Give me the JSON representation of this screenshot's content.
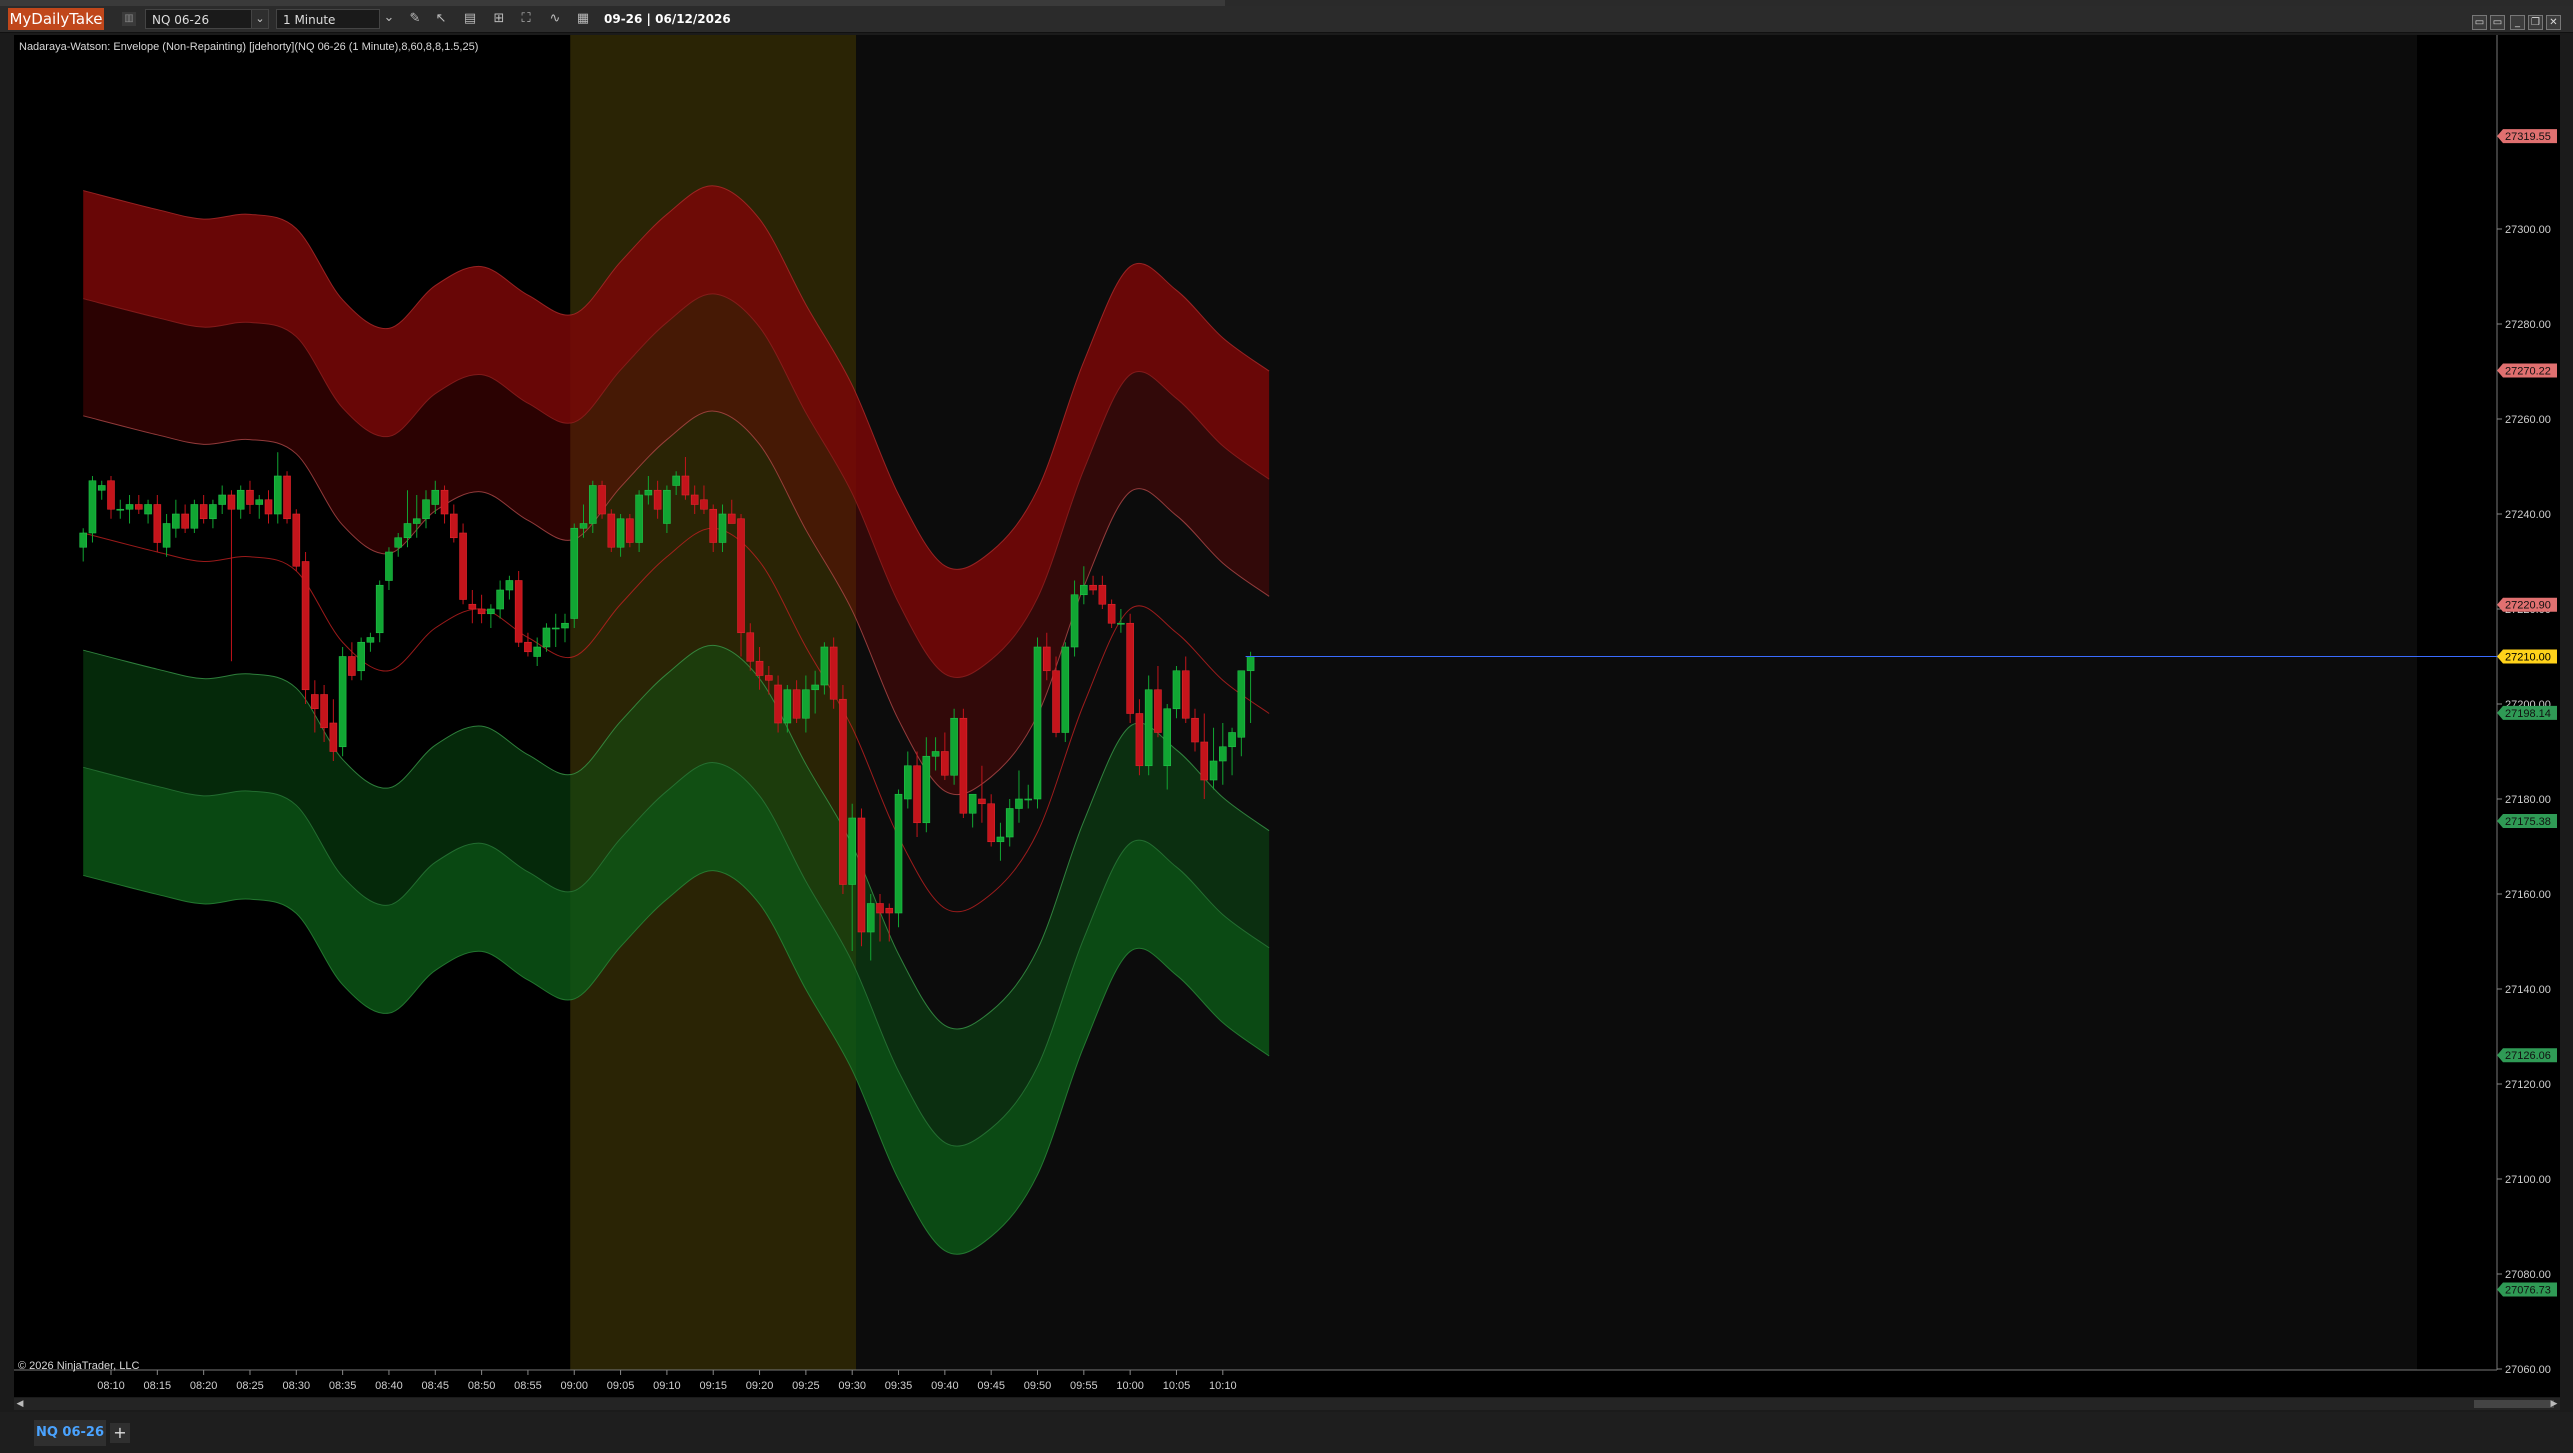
{
  "toolbar": {
    "brand": "MyDailyTake",
    "instrument": "NQ 06-26",
    "interval": "1 Minute",
    "datetime": "09-26 | 06/12/2026"
  },
  "chart": {
    "indicator_label": "Nadaraya-Watson: Envelope (Non-Repainting) [jdehorty](NQ 06-26 (1 Minute),8,60,8,8,1.5,25)",
    "copyright": "© 2026 NinjaTrader, LLC"
  },
  "tab": {
    "label": "NQ 06-26",
    "add": "+"
  },
  "colors": {
    "background": "#000000",
    "up": "#11a633",
    "down": "#c4141b",
    "band_red": "#7a0707",
    "band_green": "#0b5a16",
    "session_highlight": "#2a2405",
    "current_price": "#ffd21a"
  },
  "chart_data": {
    "type": "candlestick",
    "x_minutes": [
      488,
      494
    ],
    "ylim": [
      27060,
      27330
    ],
    "y_ticks": [
      27060,
      27080,
      27100,
      27120,
      27140,
      27160,
      27180,
      27200,
      27220,
      27240,
      27260,
      27280,
      27300
    ],
    "x_ticks": [
      "08:10",
      "08:15",
      "08:20",
      "08:25",
      "08:30",
      "08:35",
      "08:40",
      "08:45",
      "08:50",
      "08:55",
      "09:00",
      "09:05",
      "09:10",
      "09:15",
      "09:20",
      "09:25",
      "09:30",
      "09:35",
      "09:40",
      "09:45",
      "09:50",
      "09:55",
      "10:00",
      "10:05",
      "10:10"
    ],
    "time_range": [
      "08:07",
      "10:15"
    ],
    "highlight_range": [
      "09:00",
      "09:30"
    ],
    "price_labels": [
      {
        "value": 27319.55,
        "text": "27319.55",
        "color": "#e07070"
      },
      {
        "value": 27270.22,
        "text": "27270.22",
        "color": "#e07070"
      },
      {
        "value": 27220.9,
        "text": "27220.90",
        "color": "#e07070"
      },
      {
        "value": 27210.0,
        "text": "27210.00",
        "color": "#ffd21a"
      },
      {
        "value": 27198.14,
        "text": "27198.14",
        "color": "#2f9a55"
      },
      {
        "value": 27175.38,
        "text": "27175.38",
        "color": "#2f9a55"
      },
      {
        "value": 27126.06,
        "text": "27126.06",
        "color": "#2f9a55"
      },
      {
        "value": 27076.73,
        "text": "27076.73",
        "color": "#2f9a55"
      }
    ],
    "envelope": {
      "times": [
        "08:07",
        "08:15",
        "08:20",
        "08:25",
        "08:30",
        "08:35",
        "08:40",
        "08:45",
        "08:50",
        "08:55",
        "09:00",
        "09:05",
        "09:10",
        "09:15",
        "09:20",
        "09:25",
        "09:30",
        "09:35",
        "09:40",
        "09:45",
        "09:50",
        "09:55",
        "10:00",
        "10:05",
        "10:10",
        "10:15"
      ],
      "mid": [
        27236,
        27232,
        27230,
        27231,
        27228,
        27213,
        27207,
        27216,
        27220,
        27214,
        27210,
        27221,
        27231,
        27237,
        27230,
        27212,
        27195,
        27172,
        27157,
        27160,
        27173,
        27200,
        27220,
        27215,
        27205,
        27198
      ],
      "offsets": [
        24.67,
        49.33,
        72.09
      ]
    },
    "candles": [
      {
        "t": "08:07",
        "o": 27233,
        "h": 27237,
        "l": 27230,
        "c": 27236
      },
      {
        "t": "08:08",
        "o": 27236,
        "h": 27248,
        "l": 27234,
        "c": 27247
      },
      {
        "t": "08:09",
        "o": 27245,
        "h": 27247,
        "l": 27243,
        "c": 27246
      },
      {
        "t": "08:10",
        "o": 27247,
        "h": 27248,
        "l": 27239,
        "c": 27241
      },
      {
        "t": "08:11",
        "o": 27241,
        "h": 27243,
        "l": 27239,
        "c": 27241
      },
      {
        "t": "08:12",
        "o": 27241,
        "h": 27244,
        "l": 27238,
        "c": 27242
      },
      {
        "t": "08:13",
        "o": 27242,
        "h": 27244,
        "l": 27240,
        "c": 27241
      },
      {
        "t": "08:14",
        "o": 27240,
        "h": 27243,
        "l": 27238,
        "c": 27242
      },
      {
        "t": "08:15",
        "o": 27242,
        "h": 27244,
        "l": 27232,
        "c": 27234
      },
      {
        "t": "08:16",
        "o": 27233,
        "h": 27240,
        "l": 27231,
        "c": 27238
      },
      {
        "t": "08:17",
        "o": 27237,
        "h": 27243,
        "l": 27235,
        "c": 27240
      },
      {
        "t": "08:18",
        "o": 27240,
        "h": 27242,
        "l": 27236,
        "c": 27237
      },
      {
        "t": "08:19",
        "o": 27237,
        "h": 27243,
        "l": 27236,
        "c": 27242
      },
      {
        "t": "08:20",
        "o": 27242,
        "h": 27244,
        "l": 27238,
        "c": 27239
      },
      {
        "t": "08:21",
        "o": 27239,
        "h": 27243,
        "l": 27237,
        "c": 27242
      },
      {
        "t": "08:22",
        "o": 27242,
        "h": 27246,
        "l": 27240,
        "c": 27244
      },
      {
        "t": "08:23",
        "o": 27244,
        "h": 27245,
        "l": 27209,
        "c": 27241
      },
      {
        "t": "08:24",
        "o": 27241,
        "h": 27246,
        "l": 27239,
        "c": 27245
      },
      {
        "t": "08:25",
        "o": 27245,
        "h": 27247,
        "l": 27240,
        "c": 27242
      },
      {
        "t": "08:26",
        "o": 27242,
        "h": 27244,
        "l": 27239,
        "c": 27243
      },
      {
        "t": "08:27",
        "o": 27243,
        "h": 27245,
        "l": 27238,
        "c": 27240
      },
      {
        "t": "08:28",
        "o": 27240,
        "h": 27253,
        "l": 27238,
        "c": 27248
      },
      {
        "t": "08:29",
        "o": 27248,
        "h": 27249,
        "l": 27238,
        "c": 27239
      },
      {
        "t": "08:30",
        "o": 27240,
        "h": 27241,
        "l": 27228,
        "c": 27229
      },
      {
        "t": "08:31",
        "o": 27230,
        "h": 27232,
        "l": 27200,
        "c": 27203
      },
      {
        "t": "08:32",
        "o": 27202,
        "h": 27205,
        "l": 27194,
        "c": 27199
      },
      {
        "t": "08:33",
        "o": 27202,
        "h": 27204,
        "l": 27192,
        "c": 27195
      },
      {
        "t": "08:34",
        "o": 27196,
        "h": 27201,
        "l": 27188,
        "c": 27190
      },
      {
        "t": "08:35",
        "o": 27191,
        "h": 27212,
        "l": 27189,
        "c": 27210
      },
      {
        "t": "08:36",
        "o": 27210,
        "h": 27213,
        "l": 27205,
        "c": 27206
      },
      {
        "t": "08:37",
        "o": 27207,
        "h": 27214,
        "l": 27205,
        "c": 27213
      },
      {
        "t": "08:38",
        "o": 27213,
        "h": 27215,
        "l": 27211,
        "c": 27214
      },
      {
        "t": "08:39",
        "o": 27215,
        "h": 27226,
        "l": 27213,
        "c": 27225
      },
      {
        "t": "08:40",
        "o": 27226,
        "h": 27233,
        "l": 27224,
        "c": 27232
      },
      {
        "t": "08:41",
        "o": 27233,
        "h": 27236,
        "l": 27231,
        "c": 27235
      },
      {
        "t": "08:42",
        "o": 27235,
        "h": 27245,
        "l": 27233,
        "c": 27238
      },
      {
        "t": "08:43",
        "o": 27238,
        "h": 27244,
        "l": 27235,
        "c": 27239
      },
      {
        "t": "08:44",
        "o": 27239,
        "h": 27245,
        "l": 27237,
        "c": 27243
      },
      {
        "t": "08:45",
        "o": 27242,
        "h": 27247,
        "l": 27240,
        "c": 27245
      },
      {
        "t": "08:46",
        "o": 27245,
        "h": 27246,
        "l": 27238,
        "c": 27240
      },
      {
        "t": "08:47",
        "o": 27240,
        "h": 27242,
        "l": 27234,
        "c": 27235
      },
      {
        "t": "08:48",
        "o": 27236,
        "h": 27238,
        "l": 27221,
        "c": 27222
      },
      {
        "t": "08:49",
        "o": 27221,
        "h": 27224,
        "l": 27217,
        "c": 27220
      },
      {
        "t": "08:50",
        "o": 27220,
        "h": 27223,
        "l": 27217,
        "c": 27219
      },
      {
        "t": "08:51",
        "o": 27219,
        "h": 27221,
        "l": 27216,
        "c": 27220
      },
      {
        "t": "08:52",
        "o": 27220,
        "h": 27226,
        "l": 27218,
        "c": 27224
      },
      {
        "t": "08:53",
        "o": 27224,
        "h": 27227,
        "l": 27222,
        "c": 27226
      },
      {
        "t": "08:54",
        "o": 27226,
        "h": 27228,
        "l": 27212,
        "c": 27213
      },
      {
        "t": "08:55",
        "o": 27213,
        "h": 27215,
        "l": 27210,
        "c": 27211
      },
      {
        "t": "08:56",
        "o": 27210,
        "h": 27214,
        "l": 27208,
        "c": 27212
      },
      {
        "t": "08:57",
        "o": 27212,
        "h": 27217,
        "l": 27211,
        "c": 27216
      },
      {
        "t": "08:58",
        "o": 27216,
        "h": 27219,
        "l": 27212,
        "c": 27216
      },
      {
        "t": "08:59",
        "o": 27216,
        "h": 27219,
        "l": 27213,
        "c": 27217
      },
      {
        "t": "09:00",
        "o": 27218,
        "h": 27238,
        "l": 27216,
        "c": 27237
      },
      {
        "t": "09:01",
        "o": 27237,
        "h": 27242,
        "l": 27235,
        "c": 27238
      },
      {
        "t": "09:02",
        "o": 27238,
        "h": 27247,
        "l": 27236,
        "c": 27246
      },
      {
        "t": "09:03",
        "o": 27246,
        "h": 27247,
        "l": 27239,
        "c": 27240
      },
      {
        "t": "09:04",
        "o": 27240,
        "h": 27241,
        "l": 27232,
        "c": 27233
      },
      {
        "t": "09:05",
        "o": 27233,
        "h": 27240,
        "l": 27231,
        "c": 27239
      },
      {
        "t": "09:06",
        "o": 27239,
        "h": 27240,
        "l": 27233,
        "c": 27234
      },
      {
        "t": "09:07",
        "o": 27234,
        "h": 27245,
        "l": 27232,
        "c": 27244
      },
      {
        "t": "09:08",
        "o": 27244,
        "h": 27248,
        "l": 27242,
        "c": 27245
      },
      {
        "t": "09:09",
        "o": 27245,
        "h": 27247,
        "l": 27239,
        "c": 27241
      },
      {
        "t": "09:10",
        "o": 27238,
        "h": 27246,
        "l": 27236,
        "c": 27245
      },
      {
        "t": "09:11",
        "o": 27246,
        "h": 27249,
        "l": 27244,
        "c": 27248
      },
      {
        "t": "09:12",
        "o": 27248,
        "h": 27252,
        "l": 27243,
        "c": 27244
      },
      {
        "t": "09:13",
        "o": 27244,
        "h": 27246,
        "l": 27240,
        "c": 27242
      },
      {
        "t": "09:14",
        "o": 27243,
        "h": 27246,
        "l": 27240,
        "c": 27241
      },
      {
        "t": "09:15",
        "o": 27241,
        "h": 27242,
        "l": 27232,
        "c": 27234
      },
      {
        "t": "09:16",
        "o": 27234,
        "h": 27242,
        "l": 27232,
        "c": 27240
      },
      {
        "t": "09:17",
        "o": 27240,
        "h": 27243,
        "l": 27238,
        "c": 27238
      },
      {
        "t": "09:18",
        "o": 27239,
        "h": 27240,
        "l": 27210,
        "c": 27215
      },
      {
        "t": "09:19",
        "o": 27215,
        "h": 27217,
        "l": 27207,
        "c": 27209
      },
      {
        "t": "09:20",
        "o": 27209,
        "h": 27212,
        "l": 27203,
        "c": 27206
      },
      {
        "t": "09:21",
        "o": 27206,
        "h": 27208,
        "l": 27202,
        "c": 27205
      },
      {
        "t": "09:22",
        "o": 27204,
        "h": 27206,
        "l": 27194,
        "c": 27196
      },
      {
        "t": "09:23",
        "o": 27196,
        "h": 27204,
        "l": 27194,
        "c": 27203
      },
      {
        "t": "09:24",
        "o": 27203,
        "h": 27205,
        "l": 27196,
        "c": 27197
      },
      {
        "t": "09:25",
        "o": 27197,
        "h": 27206,
        "l": 27194,
        "c": 27203
      },
      {
        "t": "09:26",
        "o": 27203,
        "h": 27207,
        "l": 27198,
        "c": 27204
      },
      {
        "t": "09:27",
        "o": 27204,
        "h": 27213,
        "l": 27202,
        "c": 27212
      },
      {
        "t": "09:28",
        "o": 27212,
        "h": 27214,
        "l": 27199,
        "c": 27201
      },
      {
        "t": "09:29",
        "o": 27201,
        "h": 27204,
        "l": 27160,
        "c": 27162
      },
      {
        "t": "09:30",
        "o": 27162,
        "h": 27179,
        "l": 27148,
        "c": 27176
      },
      {
        "t": "09:31",
        "o": 27176,
        "h": 27178,
        "l": 27149,
        "c": 27152
      },
      {
        "t": "09:32",
        "o": 27152,
        "h": 27160,
        "l": 27146,
        "c": 27158
      },
      {
        "t": "09:33",
        "o": 27158,
        "h": 27160,
        "l": 27150,
        "c": 27156
      },
      {
        "t": "09:34",
        "o": 27157,
        "h": 27158,
        "l": 27150,
        "c": 27156
      },
      {
        "t": "09:35",
        "o": 27156,
        "h": 27182,
        "l": 27153,
        "c": 27181
      },
      {
        "t": "09:36",
        "o": 27180,
        "h": 27190,
        "l": 27178,
        "c": 27187
      },
      {
        "t": "09:37",
        "o": 27187,
        "h": 27190,
        "l": 27172,
        "c": 27175
      },
      {
        "t": "09:38",
        "o": 27175,
        "h": 27193,
        "l": 27173,
        "c": 27189
      },
      {
        "t": "09:39",
        "o": 27189,
        "h": 27193,
        "l": 27186,
        "c": 27190
      },
      {
        "t": "09:40",
        "o": 27190,
        "h": 27194,
        "l": 27184,
        "c": 27185
      },
      {
        "t": "09:41",
        "o": 27185,
        "h": 27199,
        "l": 27183,
        "c": 27197
      },
      {
        "t": "09:42",
        "o": 27197,
        "h": 27199,
        "l": 27176,
        "c": 27177
      },
      {
        "t": "09:43",
        "o": 27177,
        "h": 27181,
        "l": 27174,
        "c": 27181
      },
      {
        "t": "09:44",
        "o": 27180,
        "h": 27187,
        "l": 27175,
        "c": 27179
      },
      {
        "t": "09:45",
        "o": 27179,
        "h": 27181,
        "l": 27170,
        "c": 27171
      },
      {
        "t": "09:46",
        "o": 27171,
        "h": 27175,
        "l": 27167,
        "c": 27172
      },
      {
        "t": "09:47",
        "o": 27172,
        "h": 27180,
        "l": 27170,
        "c": 27178
      },
      {
        "t": "09:48",
        "o": 27178,
        "h": 27186,
        "l": 27175,
        "c": 27180
      },
      {
        "t": "09:49",
        "o": 27180,
        "h": 27183,
        "l": 27178,
        "c": 27180
      },
      {
        "t": "09:50",
        "o": 27180,
        "h": 27214,
        "l": 27178,
        "c": 27212
      },
      {
        "t": "09:51",
        "o": 27212,
        "h": 27215,
        "l": 27205,
        "c": 27207
      },
      {
        "t": "09:52",
        "o": 27207,
        "h": 27210,
        "l": 27193,
        "c": 27194
      },
      {
        "t": "09:53",
        "o": 27194,
        "h": 27213,
        "l": 27192,
        "c": 27212
      },
      {
        "t": "09:54",
        "o": 27212,
        "h": 27226,
        "l": 27210,
        "c": 27223
      },
      {
        "t": "09:55",
        "o": 27223,
        "h": 27229,
        "l": 27221,
        "c": 27225
      },
      {
        "t": "09:56",
        "o": 27225,
        "h": 27227,
        "l": 27223,
        "c": 27224
      },
      {
        "t": "09:57",
        "o": 27225,
        "h": 27227,
        "l": 27220,
        "c": 27221
      },
      {
        "t": "09:58",
        "o": 27221,
        "h": 27222,
        "l": 27216,
        "c": 27217
      },
      {
        "t": "09:59",
        "o": 27217,
        "h": 27220,
        "l": 27215,
        "c": 27217
      },
      {
        "t": "10:00",
        "o": 27217,
        "h": 27219,
        "l": 27196,
        "c": 27198
      },
      {
        "t": "10:01",
        "o": 27198,
        "h": 27201,
        "l": 27185,
        "c": 27187
      },
      {
        "t": "10:02",
        "o": 27187,
        "h": 27206,
        "l": 27185,
        "c": 27203
      },
      {
        "t": "10:03",
        "o": 27203,
        "h": 27208,
        "l": 27193,
        "c": 27194
      },
      {
        "t": "10:04",
        "o": 27187,
        "h": 27200,
        "l": 27182,
        "c": 27199
      },
      {
        "t": "10:05",
        "o": 27199,
        "h": 27208,
        "l": 27197,
        "c": 27207
      },
      {
        "t": "10:06",
        "o": 27207,
        "h": 27210,
        "l": 27196,
        "c": 27197
      },
      {
        "t": "10:07",
        "o": 27197,
        "h": 27199,
        "l": 27190,
        "c": 27192
      },
      {
        "t": "10:08",
        "o": 27192,
        "h": 27198,
        "l": 27180,
        "c": 27184
      },
      {
        "t": "10:09",
        "o": 27184,
        "h": 27195,
        "l": 27182,
        "c": 27188
      },
      {
        "t": "10:10",
        "o": 27188,
        "h": 27196,
        "l": 27183,
        "c": 27191
      },
      {
        "t": "10:11",
        "o": 27191,
        "h": 27195,
        "l": 27185,
        "c": 27194
      },
      {
        "t": "10:12",
        "o": 27193,
        "h": 27207,
        "l": 27189,
        "c": 27207
      },
      {
        "t": "10:13",
        "o": 27207,
        "h": 27211,
        "l": 27196,
        "c": 27210
      }
    ]
  }
}
